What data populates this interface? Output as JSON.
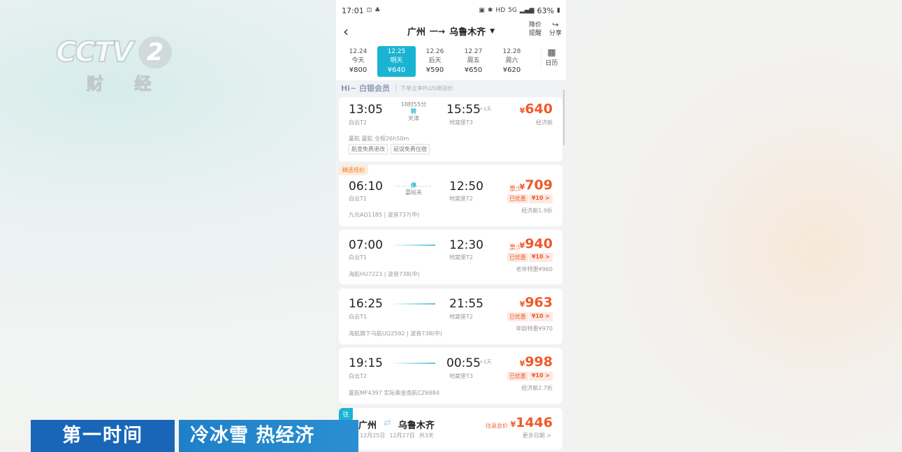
{
  "watermark": {
    "logo": "CCTV",
    "channel": "2",
    "sub": "财 经"
  },
  "status_bar": {
    "time": "17:01",
    "net": "5G",
    "hd": "HD",
    "battery": "63%"
  },
  "header": {
    "origin": "广州",
    "destination": "乌鲁木齐",
    "price_alert": "降价提醒",
    "share": "分享"
  },
  "dates": [
    {
      "date": "12.24",
      "day": "今天",
      "price": "¥800"
    },
    {
      "date": "12.25",
      "day": "明天",
      "price": "¥640"
    },
    {
      "date": "12.26",
      "day": "后天",
      "price": "¥590"
    },
    {
      "date": "12.27",
      "day": "周五",
      "price": "¥650"
    },
    {
      "date": "12.28",
      "day": "周六",
      "price": "¥620"
    }
  ],
  "calendar_label": "日历",
  "member": {
    "title": "Hi~ 白银会员",
    "subtitle": "下单立享PLUS体验价"
  },
  "flights": [
    {
      "dep": "13:05",
      "dep_airport": "白云T2",
      "arr": "15:55",
      "plus_day": "+1天",
      "arr_airport": "地窝堡T3",
      "duration": "18时55分",
      "stop_tag": "转",
      "stop_city": "天津",
      "price": "640",
      "cabin": "经济舱",
      "airline_info": "厦航  厦航  全程26h50m",
      "chips": [
        "航变免费退改",
        "延误免费住宿"
      ]
    },
    {
      "badge": "精选低价",
      "dep": "06:10",
      "dep_airport": "白云T1",
      "arr": "12:50",
      "arr_airport": "地窝堡T2",
      "stop_tag": "停",
      "stop_city": "嘉峪关",
      "price_tag": "票少",
      "price": "709",
      "disc_label": "已优惠",
      "disc_amount": "¥10 >",
      "cabin": "经济舱1.9折",
      "airline_info": "九元AQ1185 | 波音737(中)"
    },
    {
      "dep": "07:00",
      "dep_airport": "白云T1",
      "arr": "12:30",
      "arr_airport": "地窝堡T2",
      "price_tag": "票少",
      "price": "940",
      "disc_label": "已优惠",
      "disc_amount": "¥10 >",
      "cabin": "老年特惠¥960",
      "airline_info": "海航HU7223 | 波音738(中)"
    },
    {
      "dep": "16:25",
      "dep_airport": "白云T1",
      "arr": "21:55",
      "arr_airport": "地窝堡T2",
      "price": "963",
      "disc_label": "已优惠",
      "disc_amount": "¥10 >",
      "cabin": "年龄特惠¥970",
      "airline_info": "海航旗下乌航UQ2592 | 波音738(中)"
    },
    {
      "dep": "19:15",
      "dep_airport": "白云T2",
      "arr": "00:55",
      "plus_day": "+1天",
      "arr_airport": "地窝堡T3",
      "price": "998",
      "disc_label": "已优惠",
      "disc_amount": "¥10 >",
      "cabin": "经济舱2.7折",
      "airline_info": "厦航MF4397 实际乘坐南航CZ6884"
    }
  ],
  "round_trip": {
    "badge": "往",
    "origin": "广州",
    "destination": "乌鲁木齐",
    "date_out": "12月25日",
    "date_back": "12月27日",
    "nights": "共3天",
    "label": "往返总价",
    "price": "1446",
    "more": "更多日期 >"
  },
  "caption": {
    "left": "第一时间",
    "right": "冷冰雪 热经济"
  }
}
